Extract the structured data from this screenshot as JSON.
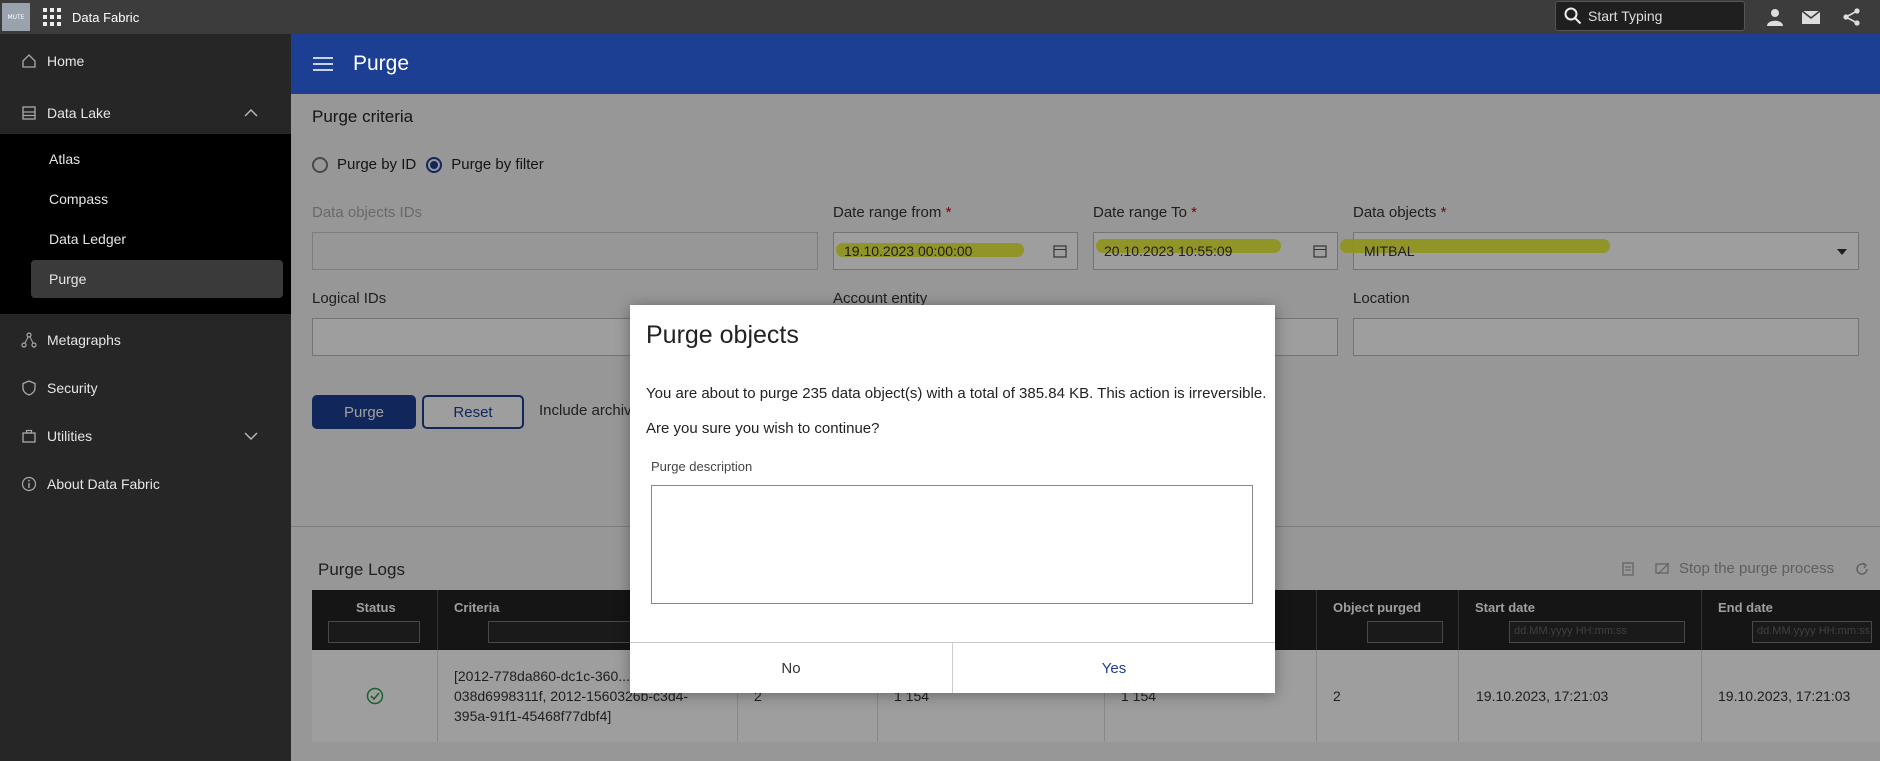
{
  "topbar": {
    "logo_text": "MUTE",
    "app_title": "Data Fabric",
    "search_placeholder": "Start Typing",
    "icons": [
      "apps-grid-icon",
      "search-icon",
      "user-icon",
      "mail-icon",
      "share-icon"
    ]
  },
  "sidebar": {
    "items": [
      {
        "label": "Home",
        "icon": "home-icon"
      },
      {
        "label": "Data Lake",
        "icon": "data-lake-icon",
        "expanded": true
      },
      {
        "label": "Metagraphs",
        "icon": "metagraphs-icon"
      },
      {
        "label": "Security",
        "icon": "shield-icon"
      },
      {
        "label": "Utilities",
        "icon": "utilities-icon",
        "expanded": false
      },
      {
        "label": "About Data Fabric",
        "icon": "info-icon"
      }
    ],
    "sub_items": [
      "Atlas",
      "Compass",
      "Data Ledger",
      "Purge"
    ],
    "active_sub": "Purge"
  },
  "header": {
    "title": "Purge"
  },
  "form": {
    "section_title": "Purge criteria",
    "radio_by_id": "Purge by ID",
    "radio_by_filter": "Purge by filter",
    "selected_radio": "Purge by filter",
    "data_objects_ids_label": "Data objects IDs",
    "date_from_label": "Date range from",
    "date_from_value": "19.10.2023 00:00:00",
    "date_to_label": "Date range To",
    "date_to_value": "20.10.2023 10:55:09",
    "data_objects_label": "Data objects",
    "data_objects_value": "MITBAL",
    "required_mark": "*",
    "logical_ids_label": "Logical IDs",
    "account_entity_label": "Account entity",
    "location_label": "Location",
    "purge_button": "Purge",
    "reset_button": "Reset",
    "include_archive_text": "Include archiv"
  },
  "logs": {
    "title": "Purge Logs",
    "stop_label": "Stop the purge process",
    "columns": [
      "Status",
      "Criteria",
      "",
      "",
      "",
      "Object purged",
      "Start date",
      "End date"
    ],
    "date_placeholder": "dd.MM.yyyy HH:mm:ss",
    "row": {
      "status": "success",
      "criteria": "[2012-778da860-dc1c-360... 038d6998311f, 2012-1560326b-c3d4-395a-91f1-45468f77dbf4]",
      "col3": "2",
      "col4": "1 154",
      "col5": "1 154",
      "object_purged": "2",
      "start_date": "19.10.2023, 17:21:03",
      "end_date": "19.10.2023, 17:21:03"
    }
  },
  "modal": {
    "title": "Purge objects",
    "message": "You are about to purge 235 data object(s) with a total of 385.84 KB. This action is irreversible.",
    "question": "Are you sure you wish to continue?",
    "description_label": "Purge description",
    "description_value": "",
    "no_label": "No",
    "yes_label": "Yes"
  },
  "colors": {
    "brand": "#1c3f94",
    "highlight": "#e8ec1e",
    "sidebar_bg": "#262626",
    "topbar_bg": "#3c3c3c"
  }
}
